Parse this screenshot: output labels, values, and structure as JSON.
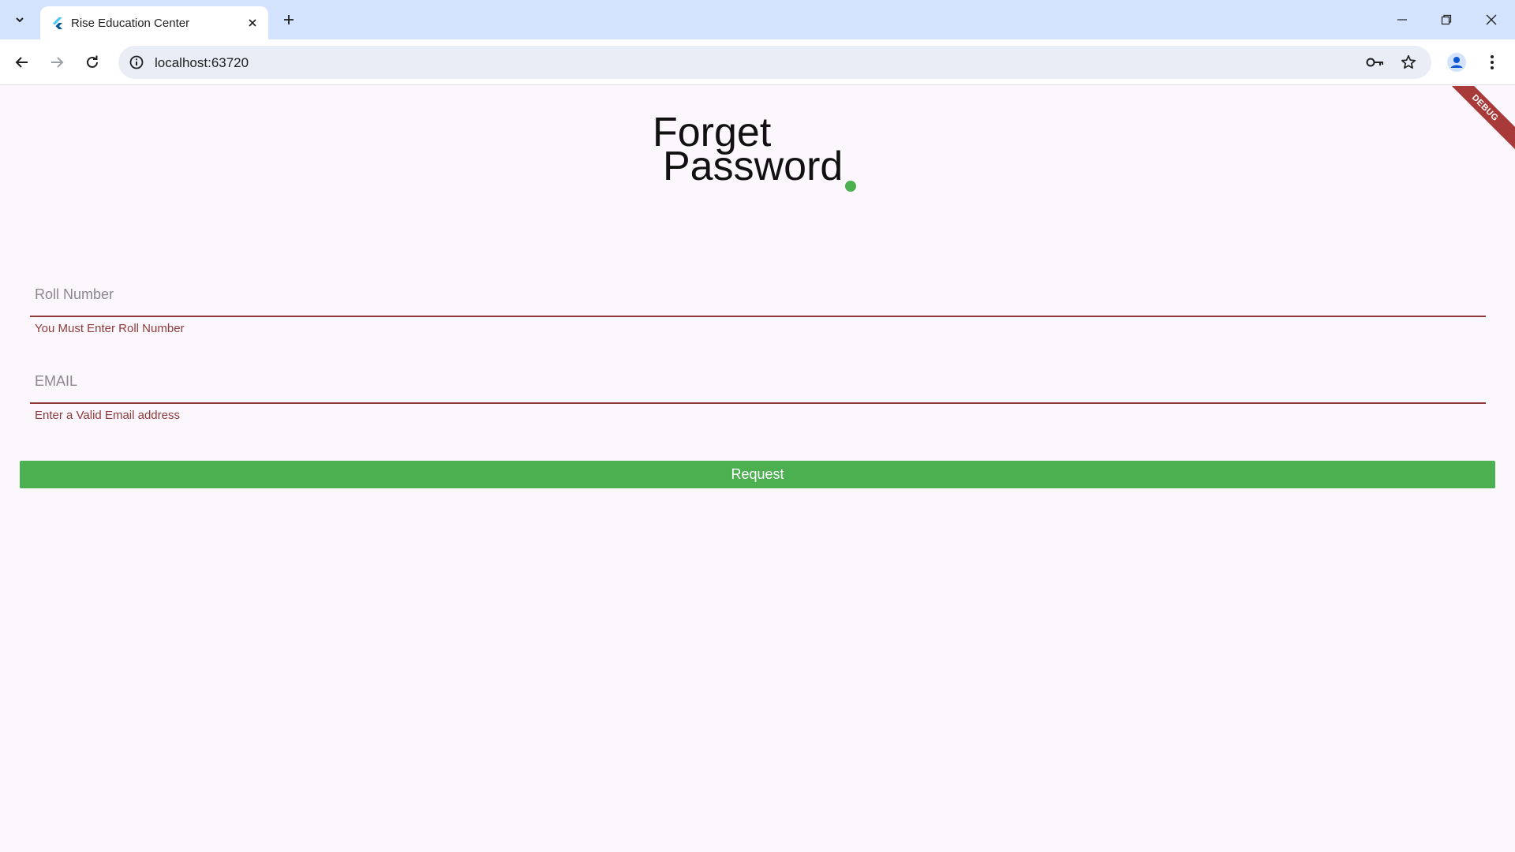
{
  "browser": {
    "tab_title": "Rise Education Center",
    "url": "localhost:63720"
  },
  "icons": {
    "tab_search": "chevron-down-icon",
    "favicon": "flutter-icon",
    "tab_close": "close-icon",
    "new_tab": "plus-icon",
    "minimize": "minimize-icon",
    "restore": "restore-icon",
    "close_window": "close-icon",
    "back": "arrow-left-icon",
    "forward": "arrow-right-icon",
    "reload": "reload-icon",
    "site_info": "info-icon",
    "password": "key-icon",
    "bookmark": "star-icon",
    "profile": "person-icon",
    "menu": "more-vert-icon"
  },
  "colors": {
    "accent": "#4caf50",
    "error": "#8f3a3a",
    "page_background": "#fcf7fc"
  },
  "debug_banner": "DEBUG",
  "form": {
    "title_line1": "Forget",
    "title_line2": "Password",
    "roll": {
      "label": "Roll Number",
      "value": "",
      "error": "You Must Enter Roll Number"
    },
    "email": {
      "label": "EMAIL",
      "value": "",
      "error": "Enter a Valid Email address"
    },
    "submit_label": "Request"
  }
}
